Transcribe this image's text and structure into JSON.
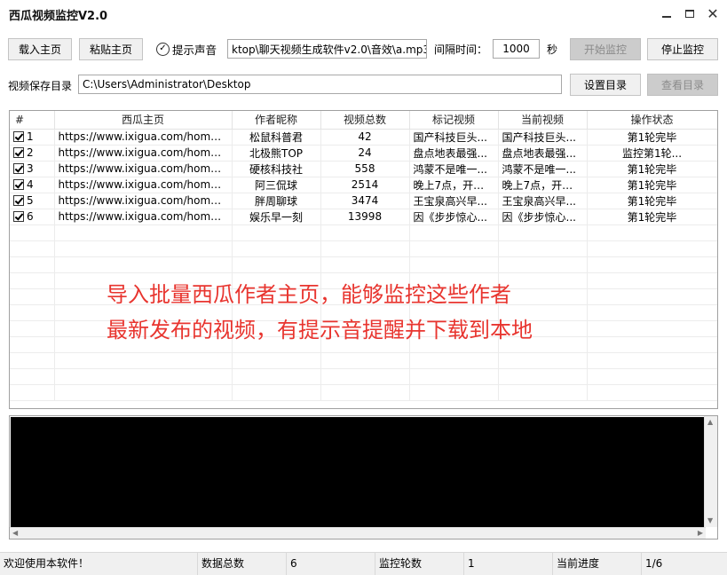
{
  "window": {
    "title": "西瓜视频监控V2.0",
    "minimize_icon": "minimize-icon",
    "maximize_icon": "maximize-icon",
    "close_icon": "close-icon",
    "close_glyph": "✕"
  },
  "toolbar": {
    "load_home_label": "载入主页",
    "paste_home_label": "粘贴主页",
    "sound_label": "提示声音",
    "sound_checked_glyph": "✓",
    "sound_file_value": "ktop\\聊天视频生成软件v2.0\\音效\\a.mp3",
    "interval_label": "间隔时间：",
    "interval_value": "1000",
    "interval_unit": "秒",
    "start_label": "开始监控",
    "stop_label": "停止监控"
  },
  "save_dir": {
    "label": "视频保存目录",
    "value": "C:\\Users\\Administrator\\Desktop",
    "set_dir_label": "设置目录",
    "view_dir_label": "查看目录"
  },
  "table": {
    "headers": [
      "#",
      "西瓜主页",
      "作者昵称",
      "视频总数",
      "标记视频",
      "当前视频",
      "操作状态"
    ],
    "rows": [
      {
        "num": "1",
        "url": "https://www.ixigua.com/home/...",
        "author": "松鼠科普君",
        "total": "42",
        "marked": "国产科技巨头...",
        "current": "国产科技巨头...",
        "status": "第1轮完毕"
      },
      {
        "num": "2",
        "url": "https://www.ixigua.com/home/...",
        "author": "北极熊TOP",
        "total": "24",
        "marked": "盘点地表最强...",
        "current": "盘点地表最强...",
        "status": "监控第1轮..."
      },
      {
        "num": "3",
        "url": "https://www.ixigua.com/home/...",
        "author": "硬核科技社",
        "total": "558",
        "marked": "鸿蒙不是唯一...",
        "current": "鸿蒙不是唯一...",
        "status": "第1轮完毕"
      },
      {
        "num": "4",
        "url": "https://www.ixigua.com/home/...",
        "author": "阿三侃球",
        "total": "2514",
        "marked": "晚上7点，开赛...",
        "current": "晚上7点，开赛...",
        "status": "第1轮完毕"
      },
      {
        "num": "5",
        "url": "https://www.ixigua.com/home/...",
        "author": "胖周聊球",
        "total": "3474",
        "marked": "王宝泉高兴早...",
        "current": "王宝泉高兴早...",
        "status": "第1轮完毕"
      },
      {
        "num": "6",
        "url": "https://www.ixigua.com/home/...",
        "author": "娱乐早一刻",
        "total": "13998",
        "marked": "因《步步惊心...",
        "current": "因《步步惊心...",
        "status": "第1轮完毕"
      }
    ]
  },
  "overlay": {
    "line1": "导入批量西瓜作者主页，能够监控这些作者",
    "line2": "最新发布的视频，有提示音提醒并下载到本地",
    "color": "#e8352f"
  },
  "status_bar": {
    "welcome": "欢迎使用本软件！",
    "total_label": "数据总数",
    "total_value": "6",
    "round_label": "监控轮数",
    "round_value": "1",
    "progress_label": "当前进度",
    "progress_value": "1/6"
  }
}
